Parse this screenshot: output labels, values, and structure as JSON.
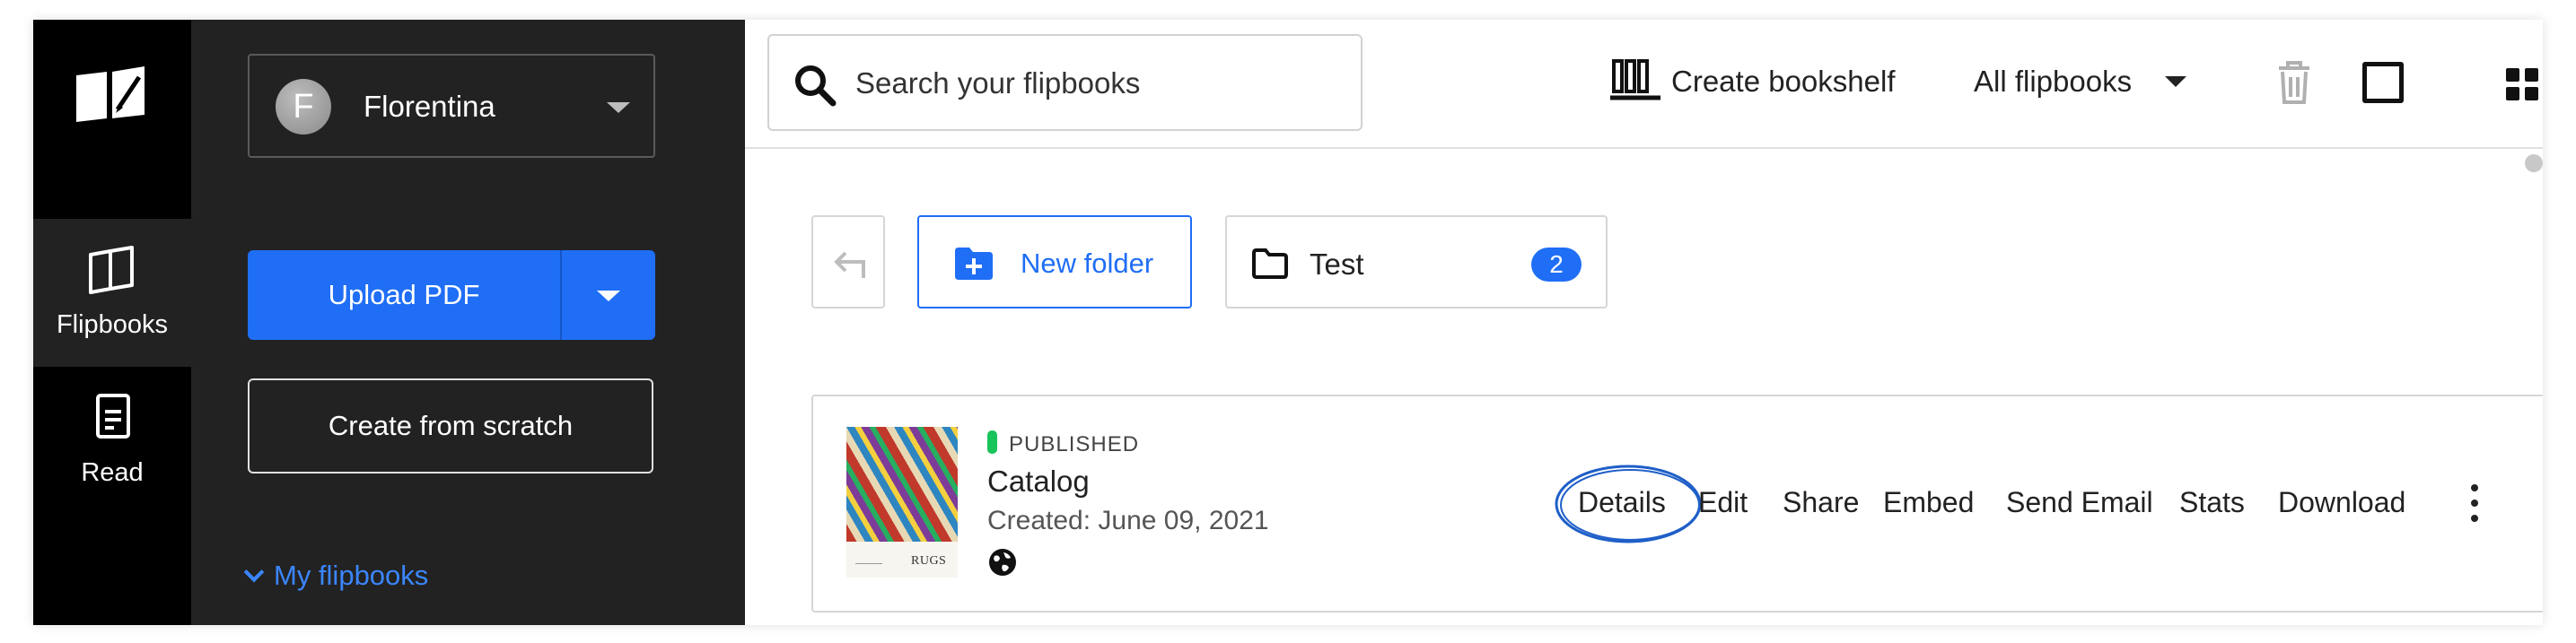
{
  "rail": {
    "items": [
      {
        "label": "Flipbooks",
        "icon": "book-open-icon",
        "active": true
      },
      {
        "label": "Read",
        "icon": "document-icon",
        "active": false
      }
    ]
  },
  "sidebar": {
    "user": {
      "initial": "F",
      "name": "Florentina"
    },
    "upload_label": "Upload PDF",
    "scratch_label": "Create from scratch",
    "my_flipbooks_label": "My flipbooks"
  },
  "topbar": {
    "search_placeholder": "Search your flipbooks",
    "create_bookshelf_label": "Create bookshelf",
    "filter_label": "All flipbooks"
  },
  "folders": {
    "new_folder_label": "New folder",
    "items": [
      {
        "name": "Test",
        "count": "2"
      }
    ]
  },
  "flipbook": {
    "status": "PUBLISHED",
    "title": "Catalog",
    "created": "Created: June 09, 2021",
    "thumbnail_text": "RUGS",
    "actions": [
      "Details",
      "Edit",
      "Share",
      "Embed",
      "Send Email",
      "Stats",
      "Download"
    ]
  },
  "colors": {
    "accent": "#1f6ef5",
    "sidebar_bg": "#222222",
    "rail_bg": "#000000",
    "published": "#19c45a"
  }
}
